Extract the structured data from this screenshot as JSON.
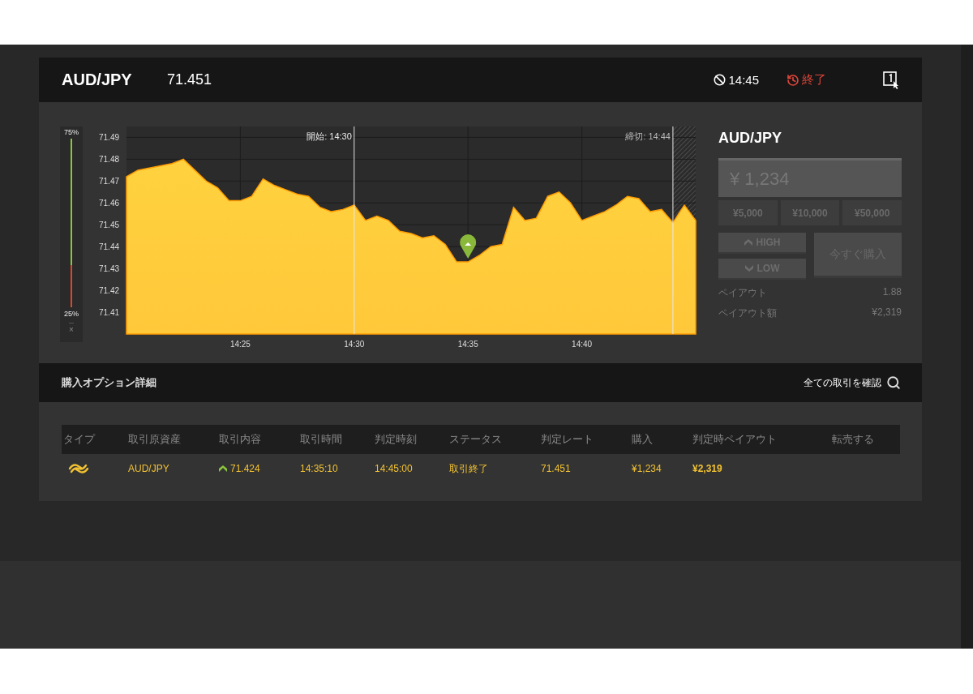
{
  "header": {
    "pair": "AUD/JPY",
    "rate": "71.451",
    "expiry": "14:45",
    "status": "終了"
  },
  "chart": {
    "indicator": {
      "high_label": "75%",
      "low_label": "25%",
      "level": 0.75,
      "close": "×"
    },
    "start_label": "開始: 14:30",
    "end_label": "締切: 14:44",
    "chart_data": {
      "type": "area",
      "categories": [
        null,
        null,
        null,
        null,
        null,
        null,
        null,
        null,
        null,
        null,
        "14:25",
        null,
        null,
        null,
        null,
        null,
        null,
        null,
        null,
        null,
        "14:30",
        null,
        null,
        null,
        null,
        null,
        null,
        null,
        null,
        null,
        "14:35",
        null,
        null,
        null,
        null,
        null,
        null,
        null,
        null,
        null,
        "14:40",
        null,
        null,
        null,
        null,
        null,
        null,
        null,
        null,
        null,
        null
      ],
      "grid": true,
      "series": [
        {
          "color": "#ff9c00",
          "values": [
            71.472,
            71.475,
            71.476,
            71.477,
            71.478,
            71.48,
            71.475,
            71.47,
            71.467,
            71.461,
            71.461,
            71.463,
            71.471,
            71.468,
            71.466,
            71.464,
            71.463,
            71.458,
            71.456,
            71.457,
            71.459,
            71.452,
            71.454,
            71.452,
            71.447,
            71.446,
            71.444,
            71.445,
            71.441,
            71.433,
            71.433,
            71.436,
            71.44,
            71.441,
            71.458,
            71.452,
            71.453,
            71.463,
            71.465,
            71.46,
            71.452,
            71.454,
            71.456,
            71.459,
            71.463,
            71.462,
            71.456,
            71.457,
            71.451,
            71.459,
            71.452
          ]
        }
      ],
      "ylim": [
        71.4,
        71.495
      ],
      "yticks": [
        {
          "value": 71.41,
          "label": "71.41"
        },
        {
          "value": 71.42,
          "label": "71.42"
        },
        {
          "value": 71.43,
          "label": "71.43"
        },
        {
          "value": 71.44,
          "label": "71.44"
        },
        {
          "value": 71.45,
          "label": "71.45"
        },
        {
          "value": 71.46,
          "label": "71.46"
        },
        {
          "value": 71.47,
          "label": "71.47"
        },
        {
          "value": 71.48,
          "label": "71.48"
        },
        {
          "value": 71.49,
          "label": "71.49"
        }
      ]
    }
  },
  "order": {
    "pair": "AUD/JPY",
    "amount_placeholder": "¥ 1,234",
    "presets": [
      "¥5,000",
      "¥10,000",
      "¥50,000"
    ],
    "high": "HIGH",
    "low": "LOW",
    "buy": "今すぐ購入",
    "disabled": true,
    "payout_rows": [
      {
        "label": "ペイアウト",
        "value": "1.88"
      },
      {
        "label": "ペイアウト額",
        "value": "¥2,319"
      }
    ]
  },
  "details": {
    "title": "購入オプション詳細",
    "link": "全ての取引を確認",
    "columns": [
      "タイプ",
      "取引原資産",
      "取引内容",
      "取引時間",
      "判定時刻",
      "ステータス",
      "判定レート",
      "購入",
      "判定時ペイアウト",
      "転売する"
    ],
    "rows": [
      {
        "asset": "AUD/JPY",
        "entry": "71.424",
        "time": "14:35:10",
        "expiry": "14:45:00",
        "status": "取引終了",
        "rate": "71.451",
        "amount": "¥1,234",
        "payout": "¥2,319"
      }
    ]
  }
}
